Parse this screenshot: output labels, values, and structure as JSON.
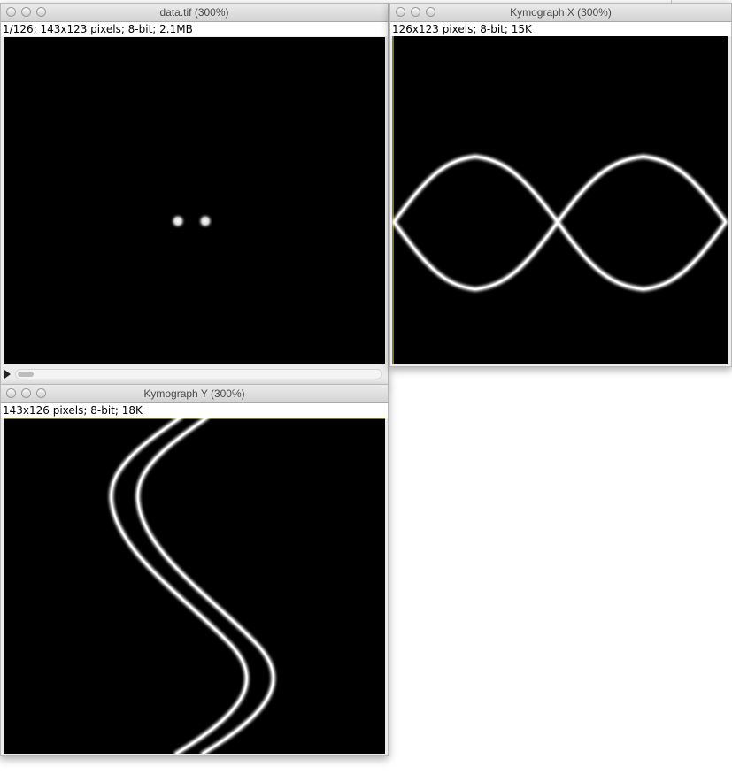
{
  "windows": {
    "data": {
      "title": "data.tif (300%)",
      "info": "1/126; 143x123 pixels; 8-bit; 2.1MB",
      "slice": {
        "current": 1,
        "total": 126
      }
    },
    "kymo_x": {
      "title": "Kymograph X (300%)",
      "info": "126x123 pixels; 8-bit; 15K"
    },
    "kymo_y": {
      "title": "Kymograph Y (300%)",
      "info": "143x126 pixels; 8-bit; 18K"
    }
  },
  "colors": {
    "image_background": "#000000",
    "signal": "#ffffff",
    "selection_line": "#f0f060"
  },
  "icons": {
    "close": "close-icon",
    "minimize": "minimize-icon",
    "zoom": "zoom-icon",
    "play": "play-icon"
  }
}
